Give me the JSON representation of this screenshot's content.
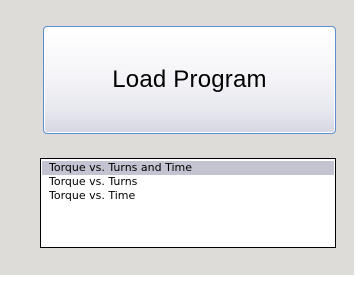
{
  "load_button": {
    "label": "Load Program"
  },
  "program_list": {
    "selected_index": 0,
    "items": [
      {
        "label": "Torque vs. Turns and Time"
      },
      {
        "label": "Torque vs. Turns"
      },
      {
        "label": "Torque vs. Time"
      }
    ]
  },
  "colors": {
    "panel_background": "#dedcd8",
    "button_border": "#5d8fd0",
    "selection_highlight": "#c3c3d1"
  }
}
